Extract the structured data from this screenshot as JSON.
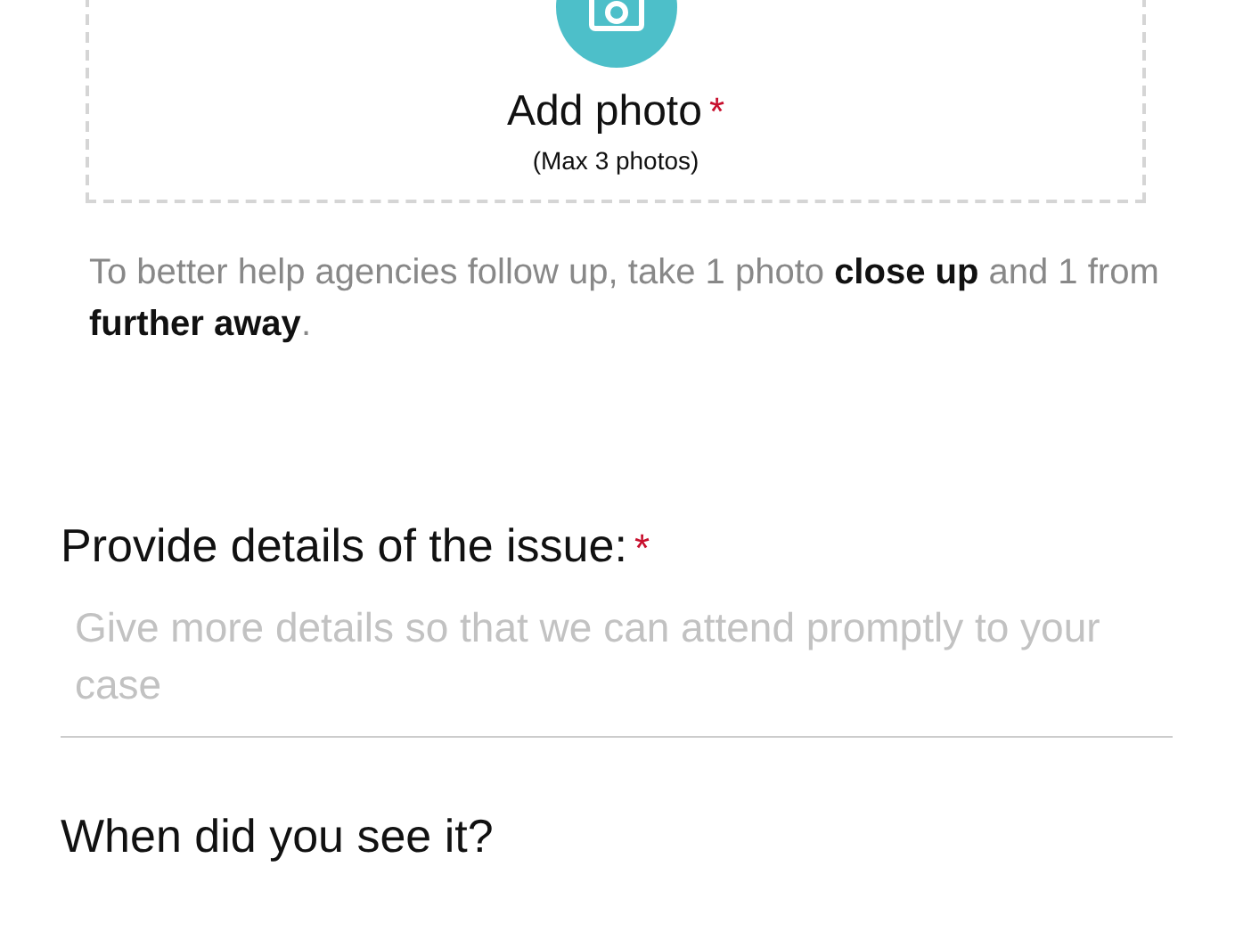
{
  "photo_upload": {
    "label": "Add photo",
    "required_mark": "*",
    "note": "(Max 3 photos)"
  },
  "photo_hint": "To better help agencies follow up, take 1 photo **close up** and 1 from **further away**.",
  "details_field": {
    "label": "Provide details of the issue:",
    "required_mark": "*",
    "placeholder": "Give more details so that we can attend promptly to your case"
  },
  "date_field": {
    "label": "When did you see it?"
  }
}
